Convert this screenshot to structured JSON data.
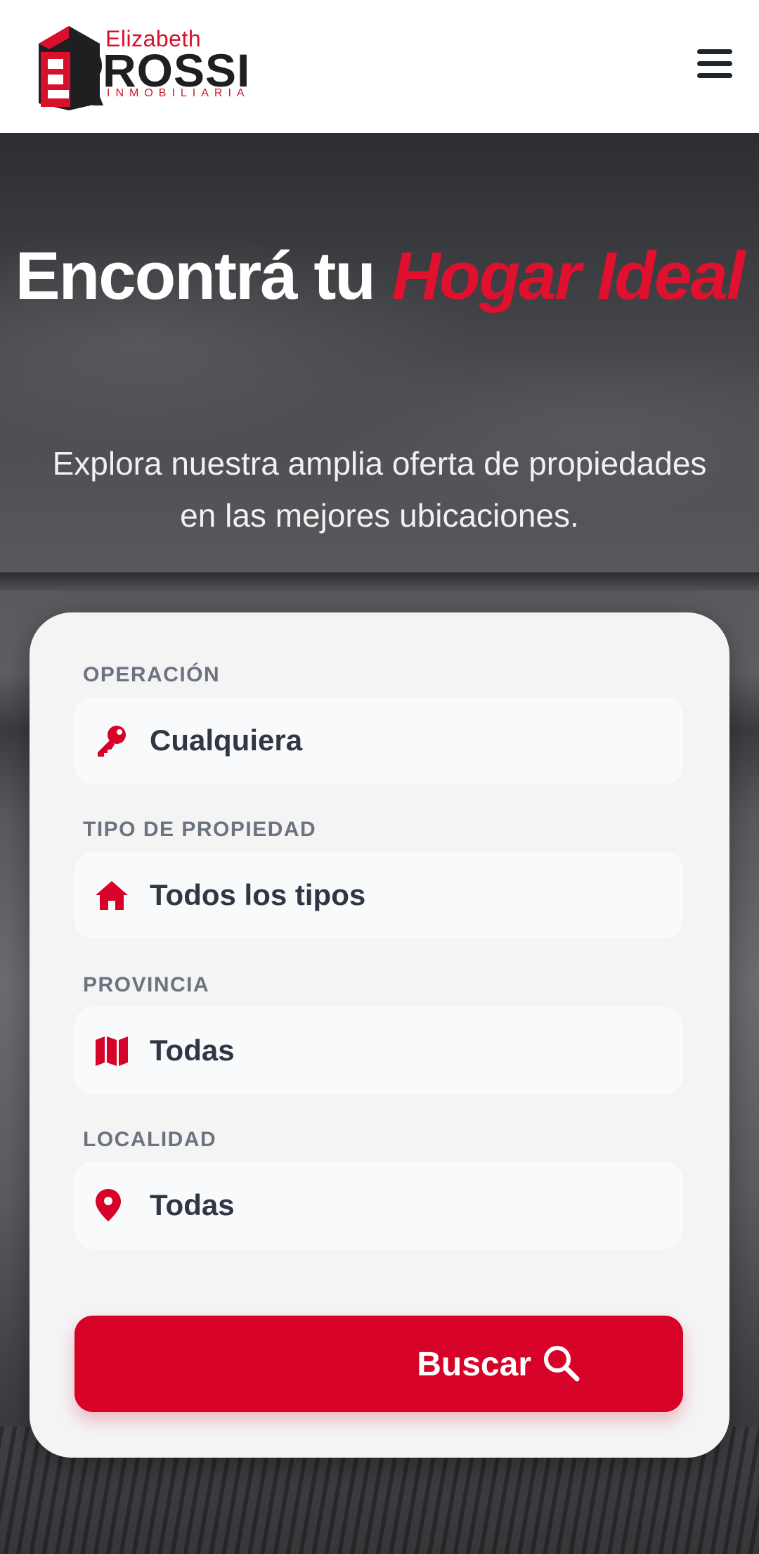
{
  "header": {
    "logo": {
      "small": "Elizabeth",
      "big": "ROSSI",
      "sub": "INMOBILIARIA",
      "monogram": "ER"
    },
    "menu_icon": "hamburger-menu-icon"
  },
  "hero": {
    "title_plain": "Encontrá tu",
    "title_accent": "Hogar Ideal",
    "subtitle": "Explora nuestra amplia oferta de propiedades en las mejores ubicaciones."
  },
  "search": {
    "fields": [
      {
        "label": "OPERACIÓN",
        "value": "Cualquiera",
        "icon": "key-icon"
      },
      {
        "label": "TIPO DE PROPIEDAD",
        "value": "Todos los tipos",
        "icon": "home-icon"
      },
      {
        "label": "PROVINCIA",
        "value": "Todas",
        "icon": "map-icon"
      },
      {
        "label": "LOCALIDAD",
        "value": "Todas",
        "icon": "map-pin-icon"
      }
    ],
    "button_label": "Buscar",
    "button_icon": "search-icon"
  },
  "colors": {
    "accent": "#d60227",
    "label_gray": "#6b7380",
    "text_dark": "#2f3644",
    "card_bg": "#f4f4f5"
  }
}
